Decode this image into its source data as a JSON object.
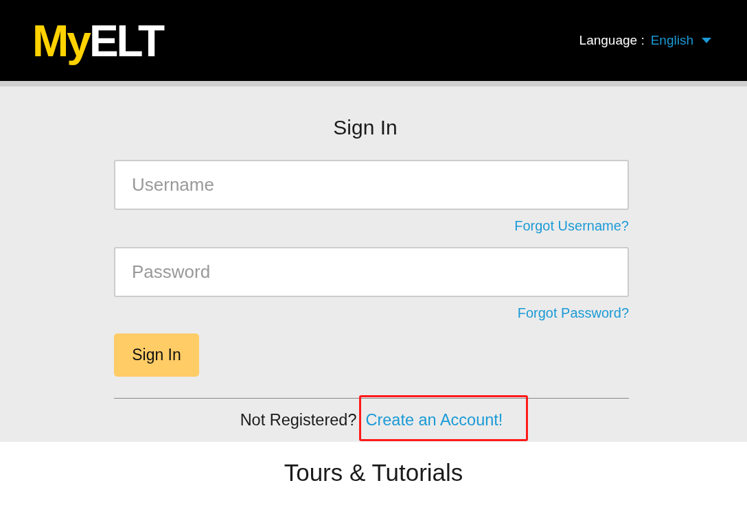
{
  "header": {
    "logo": {
      "prefix": "My",
      "suffix": "ELT"
    },
    "language": {
      "label": "Language :",
      "value": "English"
    }
  },
  "sign_in": {
    "title": "Sign In",
    "fields": [
      {
        "placeholder": "Username",
        "link": "Forgot Username?"
      },
      {
        "placeholder": "Password",
        "link": "Forgot Password?"
      }
    ],
    "button": "Sign In",
    "register": {
      "prompt": "Not Registered?",
      "link": "Create an Account!",
      "highlighted": true
    }
  },
  "tours": {
    "title": "Tours & Tutorials"
  }
}
